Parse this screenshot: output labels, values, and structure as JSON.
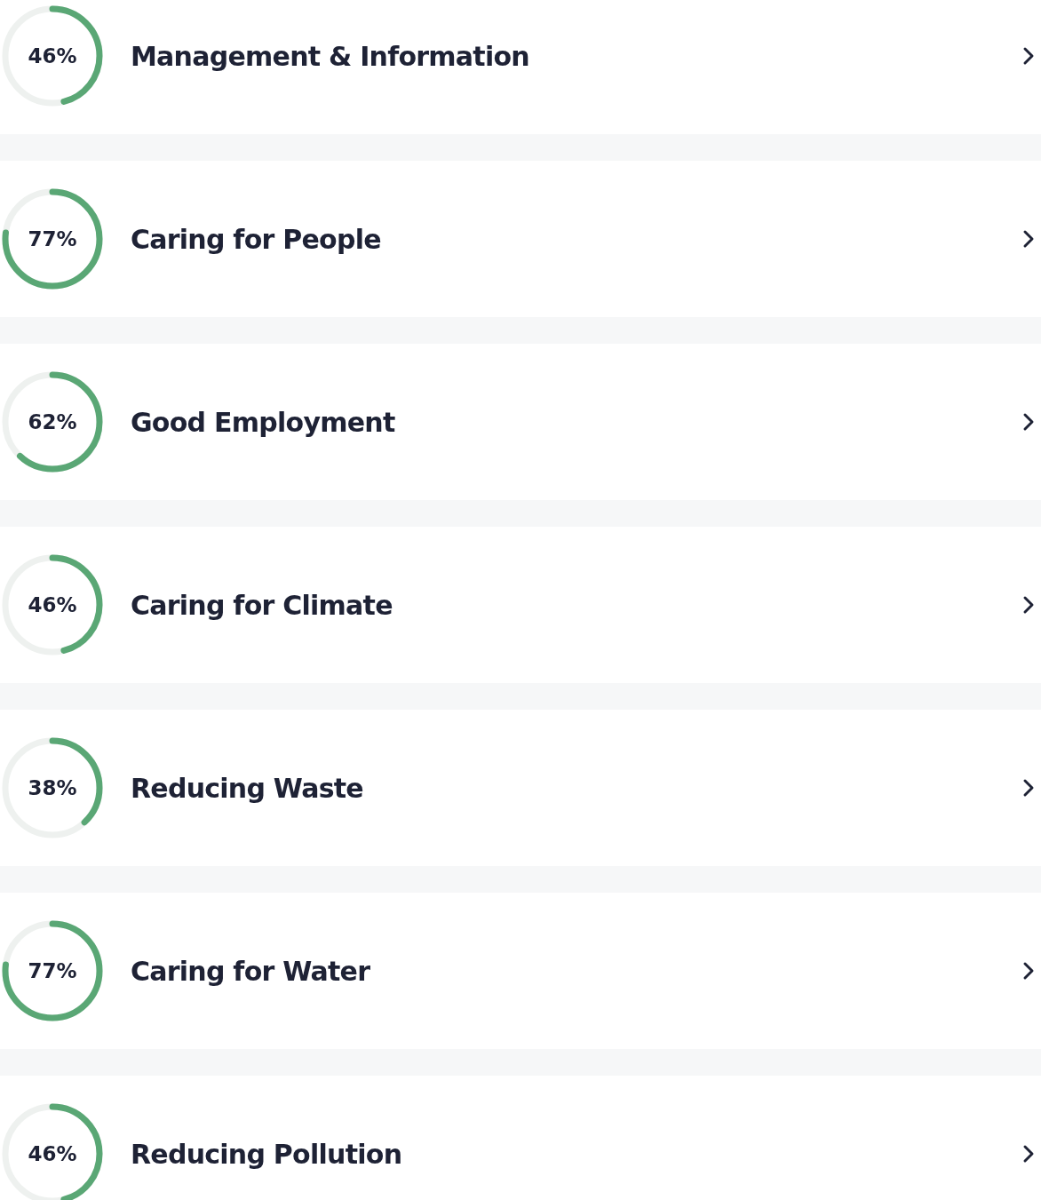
{
  "categories": [
    {
      "percent": "46%",
      "level": 0.46,
      "title": "Management & Information"
    },
    {
      "percent": "77%",
      "level": 0.77,
      "title": "Caring for People"
    },
    {
      "percent": "62%",
      "level": 0.62,
      "title": "Good Employment"
    },
    {
      "percent": "46%",
      "level": 0.46,
      "title": "Caring for Climate"
    },
    {
      "percent": "38%",
      "level": 0.38,
      "title": "Reducing Waste"
    },
    {
      "percent": "77%",
      "level": 0.77,
      "title": "Caring for Water"
    },
    {
      "percent": "46%",
      "level": 0.46,
      "title": "Reducing Pollution"
    }
  ]
}
